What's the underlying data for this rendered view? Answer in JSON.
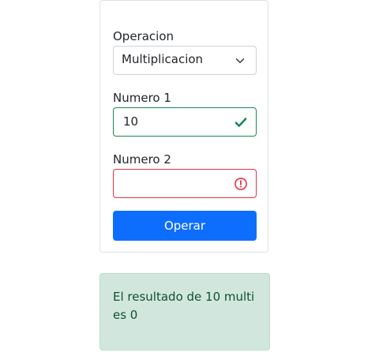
{
  "form": {
    "operation_label": "Operacion",
    "operation_selected": "Multiplicacion",
    "number1_label": "Numero 1",
    "number1_value": "10",
    "number1_state": "valid",
    "number2_label": "Numero 2",
    "number2_value": "",
    "number2_state": "invalid",
    "submit_label": "Operar"
  },
  "result": {
    "message": "El resultado de 10 multi es 0"
  },
  "icons": {
    "select_chevron": "chevron-down-icon",
    "valid": "check-icon",
    "invalid": "exclamation-circle-icon"
  },
  "colors": {
    "primary": "#0d6efd",
    "valid": "#198754",
    "invalid": "#dc3545",
    "alert_bg": "#d1e7dd",
    "alert_text": "#0f5132"
  }
}
